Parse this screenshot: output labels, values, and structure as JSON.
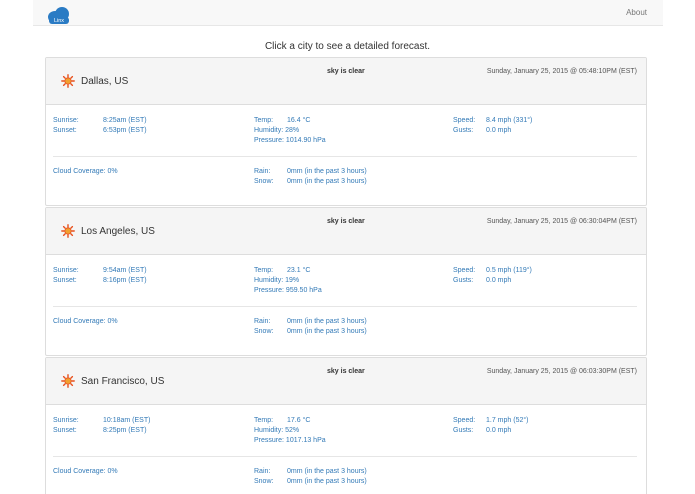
{
  "nav": {
    "brand": "Linx",
    "about": "About"
  },
  "headline": "Click a city to see a detailed forecast.",
  "cities": [
    {
      "name": "Dallas, US",
      "condition": "sky is clear",
      "datetime": "Sunday, January 25, 2015 @ 05:48:10PM (EST)",
      "sunrise_label": "Sunrise:",
      "sunrise": "8:25am (EST)",
      "sunset_label": "Sunset:",
      "sunset": "6:53pm (EST)",
      "temp_label": "Temp:",
      "temp": "16.4 °C",
      "humidity_label": "Humidity:",
      "humidity": "28%",
      "pressure_label": "Pressure:",
      "pressure": "1014.90 hPa",
      "speed_label": "Speed:",
      "speed": "8.4 mph (331°)",
      "gusts_label": "Gusts:",
      "gusts": "0.0 mph",
      "cloud_label": "Cloud Coverage:",
      "cloud": "0%",
      "rain_label": "Rain:",
      "rain": "0mm (in the past 3 hours)",
      "snow_label": "Snow:",
      "snow": "0mm (in the past 3 hours)"
    },
    {
      "name": "Los Angeles, US",
      "condition": "sky is clear",
      "datetime": "Sunday, January 25, 2015 @ 06:30:04PM (EST)",
      "sunrise_label": "Sunrise:",
      "sunrise": "9:54am (EST)",
      "sunset_label": "Sunset:",
      "sunset": "8:16pm (EST)",
      "temp_label": "Temp:",
      "temp": "23.1 °C",
      "humidity_label": "Humidity:",
      "humidity": "19%",
      "pressure_label": "Pressure:",
      "pressure": "959.50 hPa",
      "speed_label": "Speed:",
      "speed": "0.5 mph (119°)",
      "gusts_label": "Gusts:",
      "gusts": "0.0 mph",
      "cloud_label": "Cloud Coverage:",
      "cloud": "0%",
      "rain_label": "Rain:",
      "rain": "0mm (in the past 3 hours)",
      "snow_label": "Snow:",
      "snow": "0mm (in the past 3 hours)"
    },
    {
      "name": "San Francisco, US",
      "condition": "sky is clear",
      "datetime": "Sunday, January 25, 2015 @ 06:03:30PM (EST)",
      "sunrise_label": "Sunrise:",
      "sunrise": "10:18am (EST)",
      "sunset_label": "Sunset:",
      "sunset": "8:25pm (EST)",
      "temp_label": "Temp:",
      "temp": "17.6 °C",
      "humidity_label": "Humidity:",
      "humidity": "52%",
      "pressure_label": "Pressure:",
      "pressure": "1017.13 hPa",
      "speed_label": "Speed:",
      "speed": "1.7 mph (52°)",
      "gusts_label": "Gusts:",
      "gusts": "0.0 mph",
      "cloud_label": "Cloud Coverage:",
      "cloud": "0%",
      "rain_label": "Rain:",
      "rain": "0mm (in the past 3 hours)",
      "snow_label": "Snow:",
      "snow": "0mm (in the past 3 hours)"
    }
  ],
  "colors": {
    "link": "#337ab7",
    "header_bg": "#f5f5f5",
    "sun": "#e8501d",
    "brand": "#2a7bc4"
  },
  "icons": {
    "brand": "cloud-logo-icon",
    "weather": "sun-icon"
  }
}
